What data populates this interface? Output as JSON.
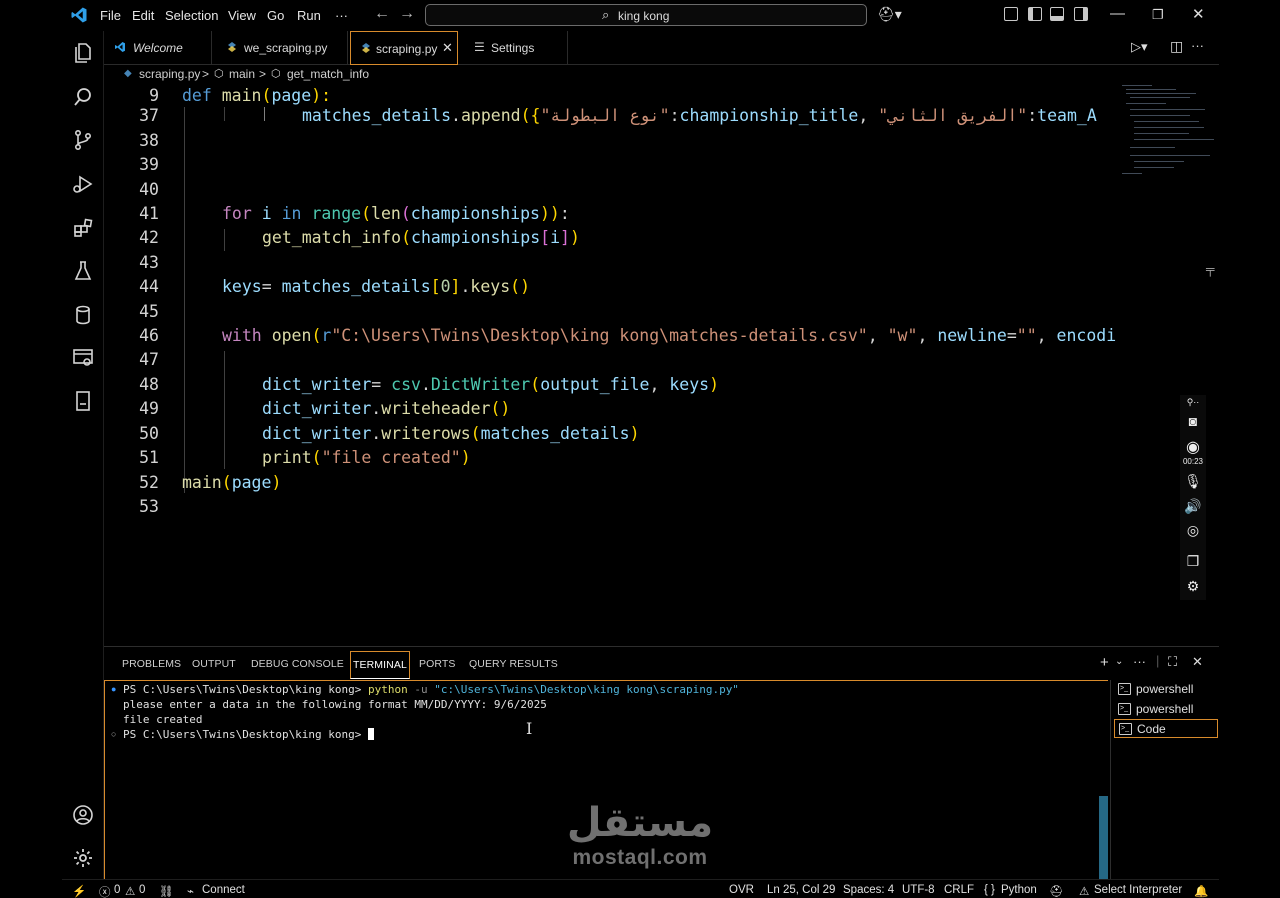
{
  "menu": [
    "File",
    "Edit",
    "Selection",
    "View",
    "Go",
    "Run",
    "···"
  ],
  "search": {
    "text": "king kong"
  },
  "tabs": [
    {
      "label": "Welcome",
      "icon": "vscode-logo-icon"
    },
    {
      "label": "we_scraping.py",
      "icon": "python-icon"
    },
    {
      "label": "scraping.py",
      "icon": "python-icon",
      "active": true
    },
    {
      "label": "Settings",
      "icon": "settings-lines-icon"
    }
  ],
  "breadcrumb": {
    "file": "scraping.py",
    "sep1": ">",
    "scope1": "main",
    "sep2": ">",
    "scope2": "get_match_info"
  },
  "editor": {
    "line_numbers": [
      "9",
      "37",
      "38",
      "39",
      "40",
      "41",
      "42",
      "43",
      "44",
      "45",
      "46",
      "47",
      "48",
      "49",
      "50",
      "51",
      "52",
      "53"
    ],
    "code": {
      "l9_kw": "def",
      "l9_fn": "main",
      "l9_p1": "(",
      "l9_arg": "page",
      "l9_p2": "):",
      "l37_a": "matches_details",
      "l37_b": ".",
      "l37_c": "append",
      "l37_d": "({",
      "l37_s1": "\"نوع البطولة\"",
      "l37_e": ":",
      "l37_f": "championship_title",
      "l37_g": ", ",
      "l37_s2": "\"الفريق الثاني\"",
      "l37_h": ":",
      "l37_i": "team_A",
      "l41_kw": "for",
      "l41_a": " i ",
      "l41_kw2": "in",
      "l41_sp": " ",
      "l41_fn1": "range",
      "l41_p1": "(",
      "l41_fn2": "len",
      "l41_p2": "(",
      "l41_v": "championships",
      "l41_p3": "))",
      "l41_c": ":",
      "l42_fn": "get_match_info",
      "l42_p1": "(",
      "l42_v": "championships",
      "l42_b1": "[",
      "l42_i": "i",
      "l42_b2": "]",
      "l42_p2": ")",
      "l44_a": "keys",
      "l44_eq": "= ",
      "l44_v": "matches_details",
      "l44_b1": "[",
      "l44_n": "0",
      "l44_b2": "]",
      "l44_dot": ".",
      "l44_fn": "keys",
      "l44_p": "()",
      "l46_kw": "with",
      "l46_sp": " ",
      "l46_fn": "open",
      "l46_p1": "(",
      "l46_r": "r",
      "l46_s": "\"C:\\Users\\Twins\\Desktop\\king kong\\matches-details.csv\"",
      "l46_c1": ", ",
      "l46_s2": "\"w\"",
      "l46_c2": ", ",
      "l46_k": "newline",
      "l46_eq": "=",
      "l46_s3": "\"\"",
      "l46_c3": ", ",
      "l46_k2": "encodi",
      "l48_a": "dict_writer",
      "l48_eq": "= ",
      "l48_m": "csv",
      "l48_dot": ".",
      "l48_cls": "DictWriter",
      "l48_p1": "(",
      "l48_v1": "output_file",
      "l48_c": ", ",
      "l48_v2": "keys",
      "l48_p2": ")",
      "l49_a": "dict_writer",
      "l49_dot": ".",
      "l49_fn": "writeheader",
      "l49_p": "()",
      "l50_a": "dict_writer",
      "l50_dot": ".",
      "l50_fn": "writerows",
      "l50_p1": "(",
      "l50_v": "matches_details",
      "l50_p2": ")",
      "l51_fn": "print",
      "l51_p1": "(",
      "l51_s": "\"file created\"",
      "l51_p2": ")",
      "l52_fn": "main",
      "l52_p1": "(",
      "l52_v": "page",
      "l52_p2": ")"
    }
  },
  "recorder": {
    "timer": "00:23"
  },
  "panel": {
    "tabs": [
      "PROBLEMS",
      "OUTPUT",
      "DEBUG CONSOLE",
      "TERMINAL",
      "PORTS",
      "QUERY RESULTS"
    ],
    "terminal_lines": {
      "prompt1": "PS C:\\Users\\Twins\\Desktop\\king kong> ",
      "cmd1": "python",
      "cmd1_flag": " -u ",
      "cmd1_path": "\"c:\\Users\\Twins\\Desktop\\king kong\\scraping.py\"",
      "out1": "please enter a data in the following format MM/DD/YYYY: 9/6/2025",
      "out2": "file created",
      "prompt2": "PS C:\\Users\\Twins\\Desktop\\king kong> "
    },
    "terminals": [
      "powershell",
      "powershell",
      "Code"
    ]
  },
  "watermark": {
    "arabic": "مستقل",
    "latin": "mostaql.com"
  },
  "statusbar": {
    "errors": "0",
    "warnings": "0",
    "connect": "Connect",
    "ovr": "OVR",
    "position": "Ln 25, Col 29",
    "spaces": "Spaces: 4",
    "encoding": "UTF-8",
    "eol": "CRLF",
    "lang_braces": "{ }",
    "language": "Python",
    "interpreter": "Select Interpreter"
  },
  "colors": {
    "accent": "#d88b2c",
    "keyword": "#569cd6",
    "function": "#dcdcaa",
    "string": "#ce9178",
    "variable": "#9cdcfe"
  }
}
